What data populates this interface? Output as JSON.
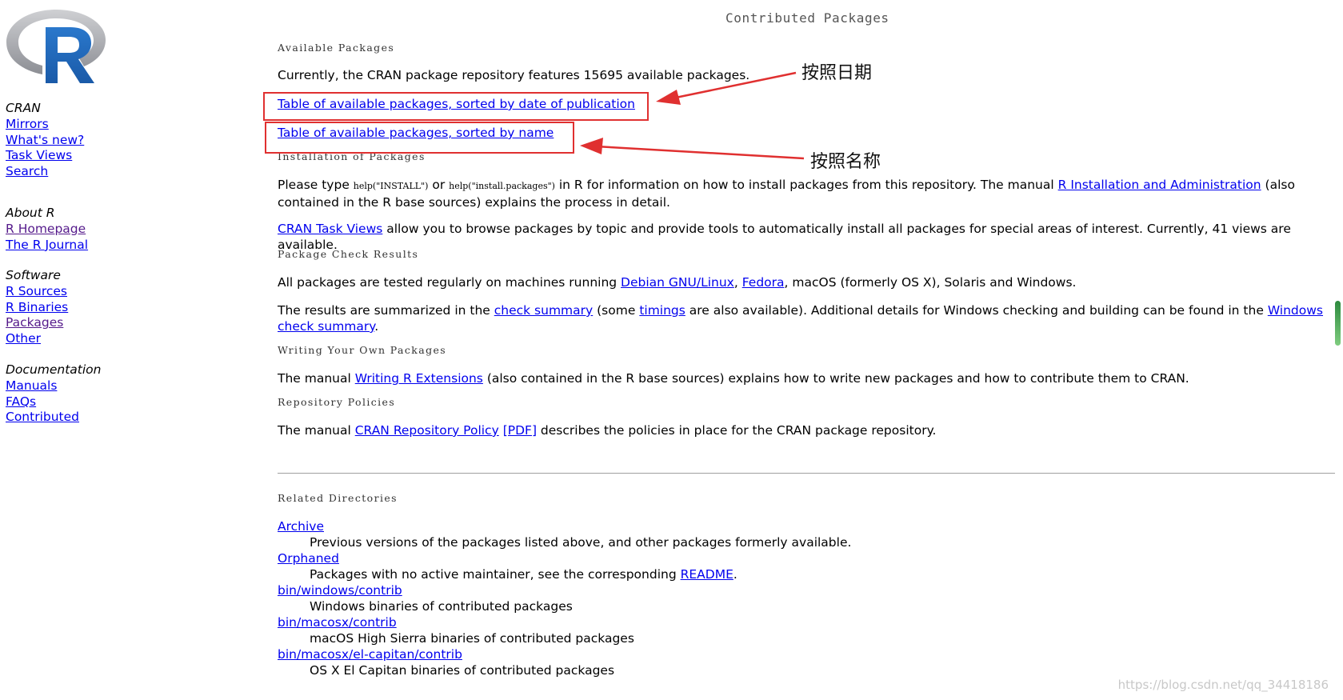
{
  "sidebar": {
    "groups": [
      {
        "heading": "CRAN",
        "links": [
          "Mirrors",
          "What's new?",
          "Task Views",
          "Search"
        ]
      },
      {
        "heading": "About R",
        "links": [
          "R Homepage",
          "The R Journal"
        ]
      },
      {
        "heading": "Software",
        "links": [
          "R Sources",
          "R Binaries",
          "Packages",
          "Other"
        ]
      },
      {
        "heading": "Documentation",
        "links": [
          "Manuals",
          "FAQs",
          "Contributed"
        ]
      }
    ]
  },
  "page": {
    "title": "Contributed Packages",
    "available": {
      "heading": "Available Packages",
      "intro": "Currently, the CRAN package repository features 15695 available packages.",
      "link_by_date": "Table of available packages, sorted by date of publication",
      "link_by_name": "Table of available packages, sorted by name"
    },
    "installation": {
      "heading": "Installation of Packages",
      "p1_a": "Please type ",
      "p1_code1": "help(\"INSTALL\")",
      "p1_or": " or ",
      "p1_code2": "help(\"install.packages\")",
      "p1_b": " in R for information on how to install packages from this repository. The manual ",
      "p1_link": "R Installation and Administration",
      "p1_c": " (also contained in the R base sources) explains the process in detail.",
      "p2_link": "CRAN Task Views",
      "p2_text": " allow you to browse packages by topic and provide tools to automatically install all packages for special areas of interest. Currently, 41 views are available."
    },
    "check": {
      "heading": "Package Check Results",
      "p1_a": "All packages are tested regularly on machines running ",
      "p1_link1": "Debian GNU/Linux",
      "p1_sep": ", ",
      "p1_link2": "Fedora",
      "p1_b": ", macOS (formerly OS X), Solaris and Windows.",
      "p2_a": "The results are summarized in the ",
      "p2_link1": "check summary",
      "p2_b": " (some ",
      "p2_link2": "timings",
      "p2_c": " are also available). Additional details for Windows checking and building can be found in the ",
      "p2_link3": "Windows check summary",
      "p2_d": "."
    },
    "writing": {
      "heading": "Writing Your Own Packages",
      "p_a": "The manual ",
      "p_link": "Writing R Extensions",
      "p_b": " (also contained in the R base sources) explains how to write new packages and how to contribute them to CRAN."
    },
    "policies": {
      "heading": "Repository Policies",
      "p_a": "The manual ",
      "p_link1": "CRAN Repository Policy",
      "p_space": " ",
      "p_link2": "[PDF]",
      "p_b": " describes the policies in place for the CRAN package repository."
    },
    "related": {
      "heading": "Related Directories",
      "items": [
        {
          "name": "Archive",
          "desc": "Previous versions of the packages listed above, and other packages formerly available."
        },
        {
          "name": "Orphaned",
          "desc": "Packages with no active maintainer, see the corresponding ",
          "desc_link": "README",
          "desc_end": "."
        },
        {
          "name": "bin/windows/contrib",
          "desc": "Windows binaries of contributed packages"
        },
        {
          "name": "bin/macosx/contrib",
          "desc": "macOS High Sierra binaries of contributed packages"
        },
        {
          "name": "bin/macosx/el-capitan/contrib",
          "desc": "OS X El Capitan binaries of contributed packages"
        }
      ]
    }
  },
  "annotations": {
    "by_date_note": "按照日期",
    "by_name_note": "按照名称",
    "color": "#e03030"
  },
  "watermark": "https://blog.csdn.net/qq_34418186",
  "colors": {
    "link": "#0000ee",
    "visited": "#551a8b",
    "logo_blue": "#2066b8",
    "logo_gray": "#9c9ea4"
  }
}
